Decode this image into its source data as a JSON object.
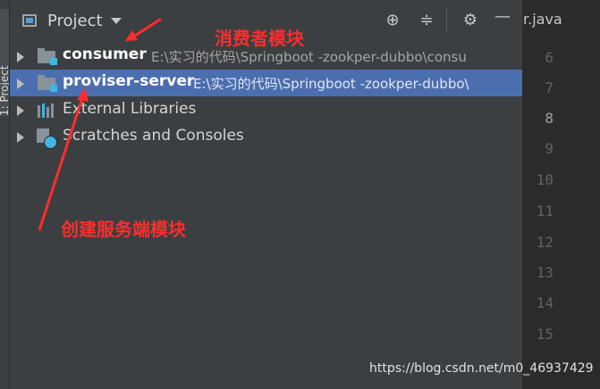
{
  "side_tab": {
    "label": "1: Project"
  },
  "toolbar": {
    "title": "Project",
    "icons": [
      "locate-icon",
      "collapse-icon",
      "gear-icon",
      "minimize-icon"
    ]
  },
  "tree": [
    {
      "name": "consumer",
      "path": "E:\\实习的代码\\Springboot -zookper-dubbo\\consu",
      "type": "module",
      "selected": false
    },
    {
      "name": "proviser-server",
      "path": "E:\\实习的代码\\Springboot -zookper-dubbo\\",
      "type": "module",
      "selected": true
    },
    {
      "name": "External Libraries",
      "type": "libraries"
    },
    {
      "name": "Scratches and Consoles",
      "type": "scratches"
    }
  ],
  "editor": {
    "tab": "r.java",
    "line_numbers": [
      "6",
      "7",
      "8",
      "9",
      "10",
      "11",
      "12",
      "13",
      "14",
      "15"
    ],
    "current_line": "8"
  },
  "annotations": {
    "consumer_module": "消费者模块",
    "create_server_module": "创建服务端模块",
    "color": "#ff2d2d"
  },
  "watermark": "https://blog.csdn.net/m0_46937429"
}
